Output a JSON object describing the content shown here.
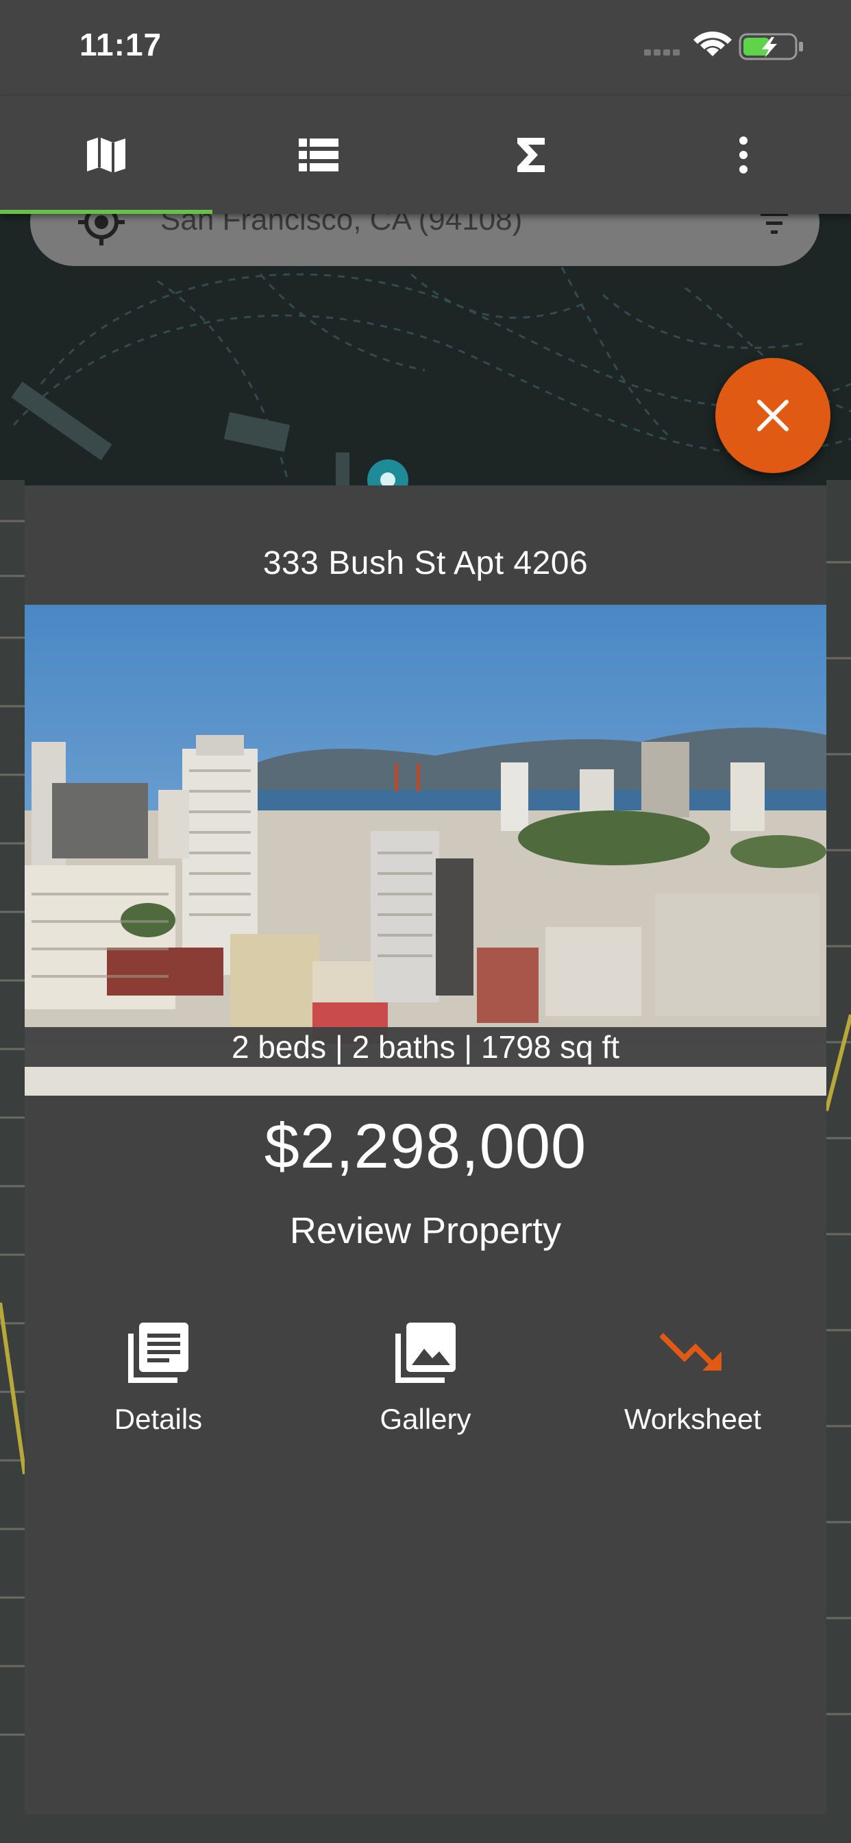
{
  "status_bar": {
    "time": "11:17"
  },
  "nav": {
    "tabs": [
      {
        "name": "map",
        "icon": "map-icon"
      },
      {
        "name": "list",
        "icon": "list-icon"
      },
      {
        "name": "summary",
        "icon": "sigma-icon"
      },
      {
        "name": "more",
        "icon": "more-vert-icon"
      }
    ],
    "active_tab": "map"
  },
  "search": {
    "value": "San Francisco, CA (94108)"
  },
  "property": {
    "address": "333 Bush St Apt 4206",
    "specs": "2 beds | 2 baths | 1798 sq ft",
    "price": "$2,298,000",
    "review_label": "Review Property",
    "actions": [
      {
        "label": "Details",
        "icon": "document-stack-icon"
      },
      {
        "label": "Gallery",
        "icon": "photo-library-icon"
      },
      {
        "label": "Worksheet",
        "icon": "trending-down-icon"
      }
    ]
  },
  "colors": {
    "accent": "#e05a14",
    "tab_indicator": "#6abf4b",
    "panel": "#424242",
    "toolbar": "#444444"
  }
}
